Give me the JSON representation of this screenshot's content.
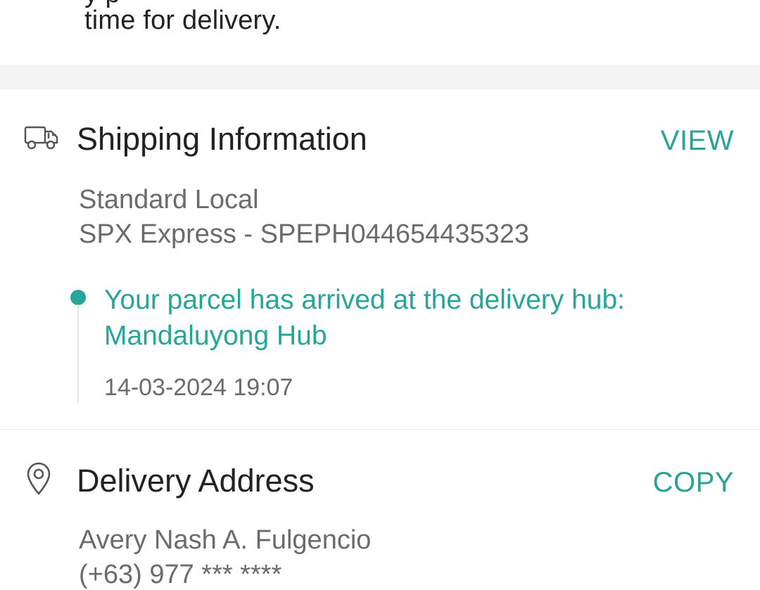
{
  "top_note": {
    "partial_line": "y          p",
    "text": "time for delivery."
  },
  "shipping": {
    "icon": "truck-icon",
    "title": "Shipping Information",
    "action": "VIEW",
    "service": "Standard Local",
    "courier": "SPX Express - SPEPH044654435323",
    "tracking": {
      "message": "Your parcel has arrived at the delivery hub: Mandaluyong Hub",
      "time": "14-03-2024 19:07"
    }
  },
  "address": {
    "icon": "location-pin-icon",
    "title": "Delivery Address",
    "action": "COPY",
    "name": "Avery Nash A. Fulgencio",
    "phone_partial": "(+63) 977 *** ****"
  },
  "colors": {
    "accent": "#26a699",
    "muted_text": "#6b6b6b",
    "divider_band": "#f4f4f4"
  }
}
